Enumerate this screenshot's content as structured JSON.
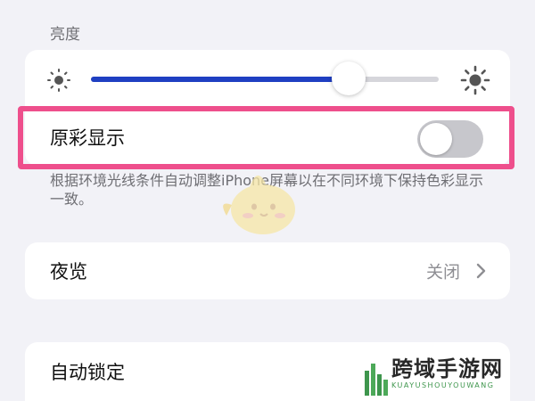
{
  "brightness": {
    "header": "亮度",
    "level": 0.74,
    "icons": {
      "low": "sun-small-icon",
      "high": "sun-large-icon"
    }
  },
  "true_tone": {
    "label": "原彩显示",
    "enabled": false,
    "description": "根据环境光线条件自动调整iPhone屏幕以在不同环境下保持色彩显示一致。"
  },
  "night_shift": {
    "label": "夜览",
    "value": "关闭",
    "icon": "chevron-right-icon"
  },
  "auto_lock": {
    "label": "自动锁定"
  },
  "watermark": {
    "text": "跨域手游网",
    "subtext": "KUAYUSHOUYOUWANG"
  },
  "colors": {
    "background": "#f2f2f7",
    "slider_fill": "#1f3fc2",
    "highlight": "#ee4f8c",
    "toggle_off": "#c7c7cc"
  }
}
